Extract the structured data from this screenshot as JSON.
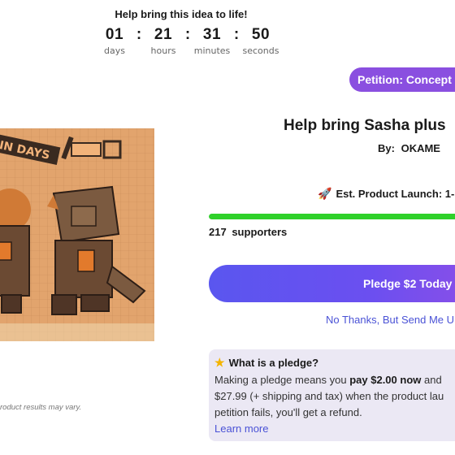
{
  "countdown": {
    "title": "Help bring this idea to life!",
    "units": [
      {
        "value": "01",
        "label": "days"
      },
      {
        "value": "21",
        "label": "hours"
      },
      {
        "value": "31",
        "label": "minutes"
      },
      {
        "value": "50",
        "label": "seconds"
      }
    ],
    "separator": ":"
  },
  "badge": {
    "label": "Petition: Concept"
  },
  "product": {
    "title": "Help bring Sasha plus",
    "by_label": "By:",
    "creator": "OKAME",
    "image_alt": "Sasha plush concept art",
    "image_text": "IN DAYS"
  },
  "launch": {
    "icon": "rocket-icon",
    "label": "Est. Product Launch: 1-"
  },
  "progress": {
    "fraction": 1.0,
    "color": "#2fd12a"
  },
  "supporters": {
    "count": "217",
    "label": "supporters"
  },
  "pledge_button": {
    "label": "Pledge $2 Today"
  },
  "no_thanks": {
    "label": "No Thanks, But Send Me U"
  },
  "pledge_info": {
    "icon": "star-icon",
    "title": "What is a pledge?",
    "line1_prefix": "Making a pledge means you ",
    "line1_bold": "pay $2.00 now",
    "line1_suffix": " and",
    "line2": "$27.99 (+ shipping and tax) when the product lau",
    "line3": "petition fails, you'll get a refund.",
    "learn_more": "Learn more"
  },
  "disclaimer": "roduct results may vary.",
  "colors": {
    "accent_purple": "#8a4fe0",
    "button_blue": "#5a56ef",
    "link_blue": "#4a52d6",
    "progress_green": "#2fd12a",
    "info_bg": "#ebe8f4"
  }
}
